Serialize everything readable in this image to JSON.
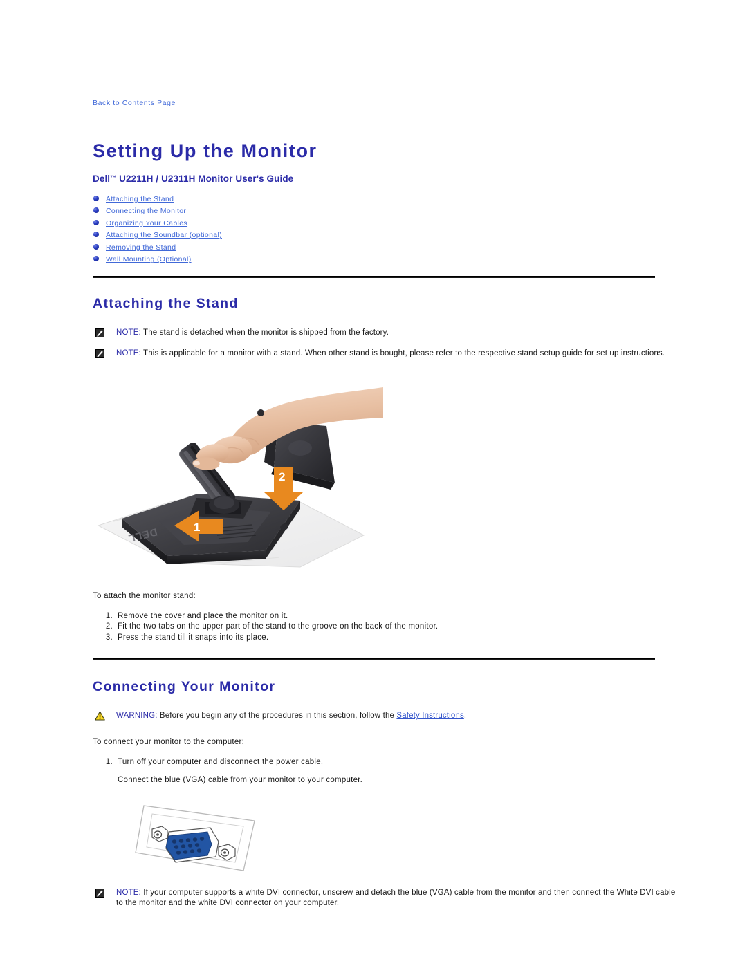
{
  "nav": {
    "back_link": "Back to Contents Page"
  },
  "header": {
    "title": "Setting Up the Monitor",
    "subtitle_pre": "Dell",
    "subtitle_tm": "™",
    "subtitle_post": " U2211H / U2311H Monitor User's Guide"
  },
  "toc": {
    "items": [
      {
        "label": "Attaching the Stand"
      },
      {
        "label": "Connecting the Monitor"
      },
      {
        "label": "Organizing Your Cables"
      },
      {
        "label": "Attaching the Soundbar (optional)"
      },
      {
        "label": "Removing the Stand"
      },
      {
        "label": "Wall Mounting (Optional)"
      }
    ]
  },
  "attaching_stand": {
    "title": "Attaching the Stand",
    "note_label_1": "NOTE:",
    "note_text_1": " The stand is detached when the monitor is shipped from the factory.",
    "note_label_2": "NOTE:",
    "note_text_2": " This is applicable for a monitor with a stand. When other stand is bought, please refer to the respective stand setup guide for set up instructions.",
    "figure": {
      "callout_1": "1",
      "callout_2": "2",
      "brand_mark": "DELL",
      "arrow_color": "#e8891f",
      "stand_color": "#3a3a3c",
      "skin_color": "#ebc4a8"
    },
    "intro": "To attach the monitor stand:",
    "steps": [
      {
        "num": "1.",
        "text": "Remove the cover and place the monitor on it."
      },
      {
        "num": "2.",
        "text": "Fit the two tabs on the upper part of the stand to the groove on the back of the monitor."
      },
      {
        "num": "3.",
        "text": "Press the stand till it snaps into its place."
      }
    ]
  },
  "connecting_monitor": {
    "title": "Connecting Your Monitor",
    "warning_label": "WARNING:",
    "warning_text_pre": " Before you begin any of the procedures in this section, follow the ",
    "warning_link": "Safety Instructions",
    "warning_text_post": ".",
    "intro": "To connect your monitor to the computer:",
    "step_1_num": "1.",
    "step_1_text": "Turn off your computer and disconnect the power cable.",
    "step_1_sub": "Connect the blue (VGA) cable from your monitor to your computer.",
    "vga_figure": {
      "connector_color": "#2255a4"
    },
    "note_label": "NOTE:",
    "note_text": "  If your computer supports a white DVI connector, unscrew and detach the blue (VGA) cable from the monitor and then connect the White DVI cable to the monitor and the white DVI connector on your computer."
  },
  "colors": {
    "heading_blue": "#2b2ba8",
    "link_blue": "#4169d8",
    "inline_link_blue": "#3355cc",
    "rule_black": "#1a1a1a",
    "warning_yellow": "#ffdd22"
  }
}
